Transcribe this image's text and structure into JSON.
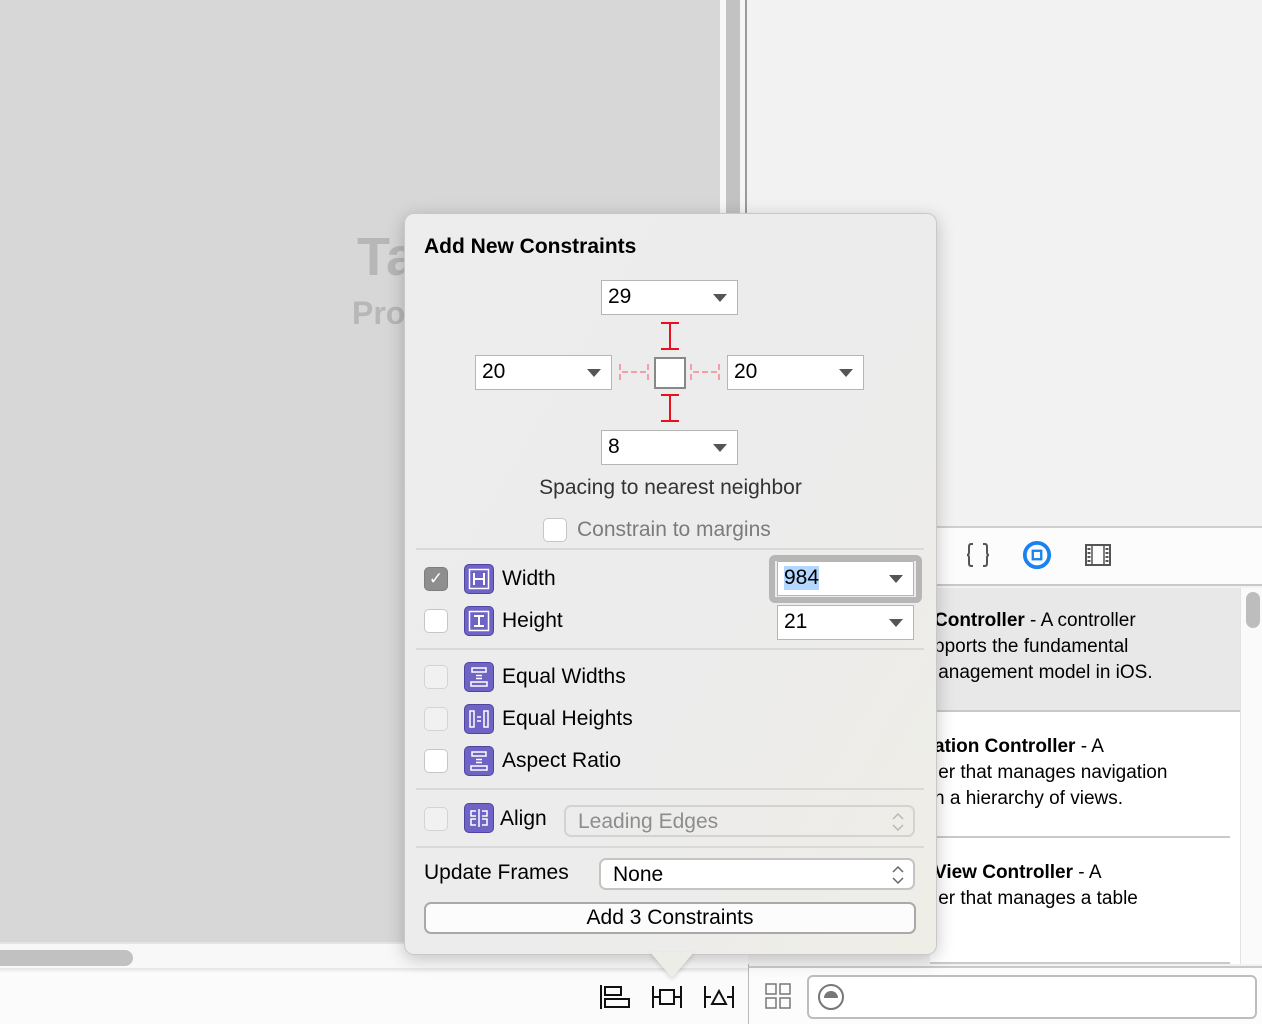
{
  "canvas": {
    "ghost_title": "Ta",
    "ghost_subtitle": "Pro"
  },
  "popover": {
    "title": "Add New Constraints",
    "spacing": {
      "top": "29",
      "left": "20",
      "right": "20",
      "bottom": "8"
    },
    "spacing_label": "Spacing to nearest neighbor",
    "constrain_to_margins": {
      "label": "Constrain to margins",
      "checked": false
    },
    "width": {
      "label": "Width",
      "checked": true,
      "value": "984"
    },
    "height": {
      "label": "Height",
      "checked": false,
      "value": "21"
    },
    "equal_widths": {
      "label": "Equal Widths",
      "checked": false
    },
    "equal_heights": {
      "label": "Equal Heights",
      "checked": false
    },
    "aspect_ratio": {
      "label": "Aspect Ratio",
      "checked": false
    },
    "align": {
      "label": "Align",
      "checked": false,
      "value": "Leading Edges"
    },
    "update_frames": {
      "label": "Update Frames",
      "value": "None"
    },
    "add_button": "Add 3 Constraints",
    "check_glyph": "✓"
  },
  "library": {
    "tabs": [
      {
        "name": "file-template-library",
        "icon": "braces-icon"
      },
      {
        "name": "object-library",
        "icon": "object-circle-icon",
        "active": true,
        "color": "#1a82f0"
      },
      {
        "name": "media-library",
        "icon": "film-strip-icon"
      }
    ],
    "items": [
      {
        "title": "Controller",
        "desc_1": " - A controller",
        "line2": "pports the fundamental",
        "line3": "ianagement model in iOS.",
        "selected": true
      },
      {
        "title": "ation Controller",
        "desc_1": " - A",
        "line2": "ler that manages navigation",
        "line3": "n a hierarchy of views.",
        "selected": false
      },
      {
        "title": "View Controller",
        "desc_1": " - A",
        "line2": "ler that manages a table",
        "line3": "",
        "selected": false
      }
    ]
  },
  "bottom_toolbar": {
    "buttons": [
      "align-button",
      "pin-button",
      "resolve-auto-layout-button"
    ]
  },
  "filter_bar": {
    "view_mode_icon": "grid-icon",
    "filter_icon": "filter-icon",
    "filter_value": ""
  }
}
